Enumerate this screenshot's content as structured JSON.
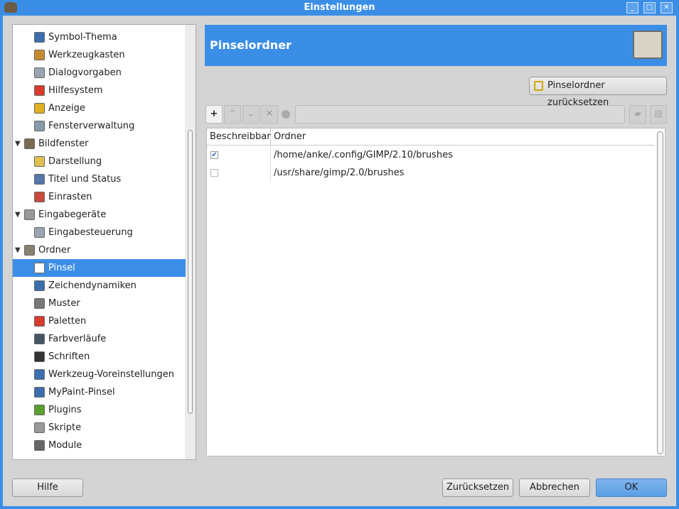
{
  "window": {
    "title": "Einstellungen",
    "minimize": "_",
    "maximize": "□",
    "close": "✕"
  },
  "sidebar": {
    "items": [
      {
        "label": "Symbol-Thema",
        "indent": 1,
        "color": "#3b6fb0"
      },
      {
        "label": "Werkzeugkasten",
        "indent": 1,
        "color": "#c88a2e"
      },
      {
        "label": "Dialogvorgaben",
        "indent": 1,
        "color": "#9aa4b0"
      },
      {
        "label": "Hilfesystem",
        "indent": 1,
        "color": "#d83a2e"
      },
      {
        "label": "Anzeige",
        "indent": 1,
        "color": "#e0b020"
      },
      {
        "label": "Fensterverwaltung",
        "indent": 1,
        "color": "#8899aa"
      },
      {
        "label": "Bildfenster",
        "indent": 0,
        "color": "#7a6a50",
        "expanded": true
      },
      {
        "label": "Darstellung",
        "indent": 1,
        "color": "#e0c050"
      },
      {
        "label": "Titel und Status",
        "indent": 1,
        "color": "#5577aa"
      },
      {
        "label": "Einrasten",
        "indent": 1,
        "color": "#c84a3a"
      },
      {
        "label": "Eingabegeräte",
        "indent": 0,
        "color": "#999999",
        "expanded": true
      },
      {
        "label": "Eingabesteuerung",
        "indent": 1,
        "color": "#9aa4b0"
      },
      {
        "label": "Ordner",
        "indent": 0,
        "color": "#8a8070",
        "expanded": true
      },
      {
        "label": "Pinsel",
        "indent": 1,
        "color": "#ffffff",
        "selected": true
      },
      {
        "label": "Zeichendynamiken",
        "indent": 1,
        "color": "#3b6fb0"
      },
      {
        "label": "Muster",
        "indent": 1,
        "color": "#777777"
      },
      {
        "label": "Paletten",
        "indent": 1,
        "color": "#d83a2e"
      },
      {
        "label": "Farbverläufe",
        "indent": 1,
        "color": "#445566"
      },
      {
        "label": "Schriften",
        "indent": 1,
        "color": "#333333"
      },
      {
        "label": "Werkzeug-Voreinstellungen",
        "indent": 1,
        "color": "#3b6fb0"
      },
      {
        "label": "MyPaint-Pinsel",
        "indent": 1,
        "color": "#3b6fb0"
      },
      {
        "label": "Plugins",
        "indent": 1,
        "color": "#5aa02c"
      },
      {
        "label": "Skripte",
        "indent": 1,
        "color": "#999999"
      },
      {
        "label": "Module",
        "indent": 1,
        "color": "#666666"
      }
    ]
  },
  "header": {
    "title": "Pinselordner"
  },
  "reset_folders_label": "Pinselordner zurücksetzen",
  "table": {
    "columns": [
      "Beschreibbar",
      "Ordner"
    ],
    "rows": [
      {
        "writable": true,
        "path": "/home/anke/.config/GIMP/2.10/brushes"
      },
      {
        "writable": false,
        "path": "/usr/share/gimp/2.0/brushes"
      }
    ]
  },
  "footer": {
    "help": "Hilfe",
    "reset": "Zurücksetzen",
    "cancel": "Abbrechen",
    "ok": "OK"
  }
}
